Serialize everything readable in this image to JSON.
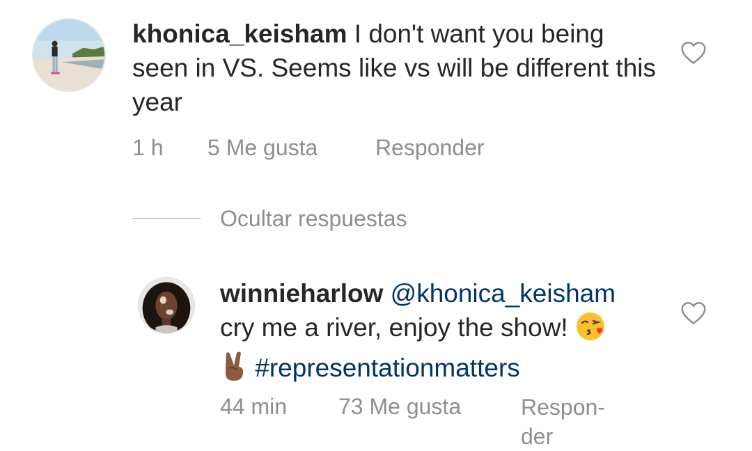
{
  "comments": [
    {
      "username": "khonica_keisham",
      "text": " I don't want you being seen in VS. Seems like vs will be different this year",
      "time": "1 h",
      "likes": "5 Me gusta",
      "reply": "Responder"
    },
    {
      "username": "winnieharlow",
      "mention": "@khonica_keisham",
      "text_line": "cry me a river, enjoy the show!",
      "hashtag": "#representationmatters",
      "emojis": [
        "kissing-face-heart",
        "victory-hand-medium-dark"
      ],
      "time": "44 min",
      "likes": "73 Me gusta",
      "reply_line1": "Respon-",
      "reply_line2": "der"
    }
  ],
  "replies_toggle": "Ocultar respuestas",
  "colors": {
    "text": "#262626",
    "meta": "#8e8e8e",
    "link": "#003569"
  }
}
